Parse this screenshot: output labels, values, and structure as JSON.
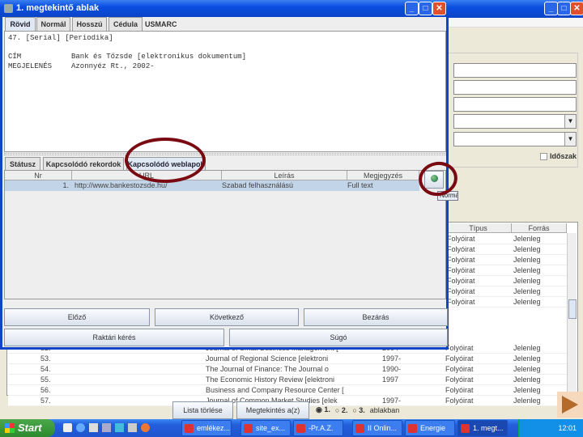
{
  "dialog": {
    "title": "1. megtekintő ablak",
    "tabs": [
      "Rövid",
      "Normál",
      "Hosszú",
      "Cédula",
      "USMARC"
    ],
    "record_lines": [
      {
        "label": "47. [Serial] [Periodika]",
        "value": ""
      },
      {
        "label": "CÍM",
        "value": "Bank és Tőzsde [elektronikus dokumentum]"
      },
      {
        "label": "MEGJELENÉS",
        "value": "Azonnyéz Rt., 2002-"
      }
    ],
    "lower_tabs": [
      "Státusz",
      "Kapcsolódó rekordok",
      "Kapcsolódó weblapok"
    ],
    "table": {
      "headers": [
        "Nr",
        "URL",
        "Leírás",
        "Megjegyzés"
      ],
      "rows": [
        {
          "nr": "1.",
          "url": "http://www.bankestozsde.hu/",
          "leiras": "Szabad felhasználású",
          "megj": "Full text"
        }
      ]
    },
    "tooltip": "Normál",
    "buttons": {
      "prev": "Előző",
      "next": "Következő",
      "close": "Bezárás",
      "request": "Raktári kérés",
      "help": "Súgó"
    }
  },
  "background": {
    "checkbox_label": "Időszak",
    "columns": [
      "Típus",
      "Forrás"
    ],
    "right_rows": [
      [
        "Folyóirat",
        "Jelenleg"
      ],
      [
        "Folyóirat",
        "Jelenleg"
      ],
      [
        "Folyóirat",
        "Jelenleg"
      ],
      [
        "Folyóirat",
        "Jelenleg"
      ],
      [
        "Folyóirat",
        "Jelenleg"
      ],
      [
        "Folyóirat",
        "Jelenleg"
      ],
      [
        "Folyóirat",
        "Jelenleg"
      ],
      [
        "Folyóirat",
        "Jelenleg"
      ],
      [
        "Folyóirat",
        "Jelenleg"
      ],
      [
        "Folyóirat",
        "Jelenleg"
      ]
    ],
    "rows": [
      {
        "nr": "52.",
        "title": "Journal of Small Business Management [",
        "year": "2004-",
        "type": "Folyóirat",
        "src": "Jelenleg"
      },
      {
        "nr": "53.",
        "title": "Journal of Regional Science [elektroni",
        "year": "1997-",
        "type": "Folyóirat",
        "src": "Jelenleg"
      },
      {
        "nr": "54.",
        "title": "The Journal of Finance: The Journal o",
        "year": "1990-",
        "type": "Folyóirat",
        "src": "Jelenleg"
      },
      {
        "nr": "55.",
        "title": "The Economic History Review [elektroni",
        "year": "1997",
        "type": "Folyóirat",
        "src": "Jelenleg"
      },
      {
        "nr": "56.",
        "title": "Business and Company Resource Center [",
        "year": "",
        "type": "Folyóirat",
        "src": "Jelenleg"
      },
      {
        "nr": "57.",
        "title": "Journal of Common Market Studies [elek",
        "year": "1997-",
        "type": "Folyóirat",
        "src": "Jelenleg"
      }
    ],
    "clear_list": "Lista törlése",
    "view_in": "Megtekintés a(z)",
    "radios": [
      "1.",
      "2.",
      "3."
    ],
    "window_suffix": "ablakban"
  },
  "taskbar": {
    "start": "Start",
    "tasks": [
      "emlékez...",
      "site_ex...",
      "-Pr.A.Z.",
      "II Onlin...",
      "Energie",
      "1. megt..."
    ],
    "clock": "12:01"
  },
  "colors": {
    "accent": "#1045c8",
    "annotation": "#7a0a12"
  }
}
